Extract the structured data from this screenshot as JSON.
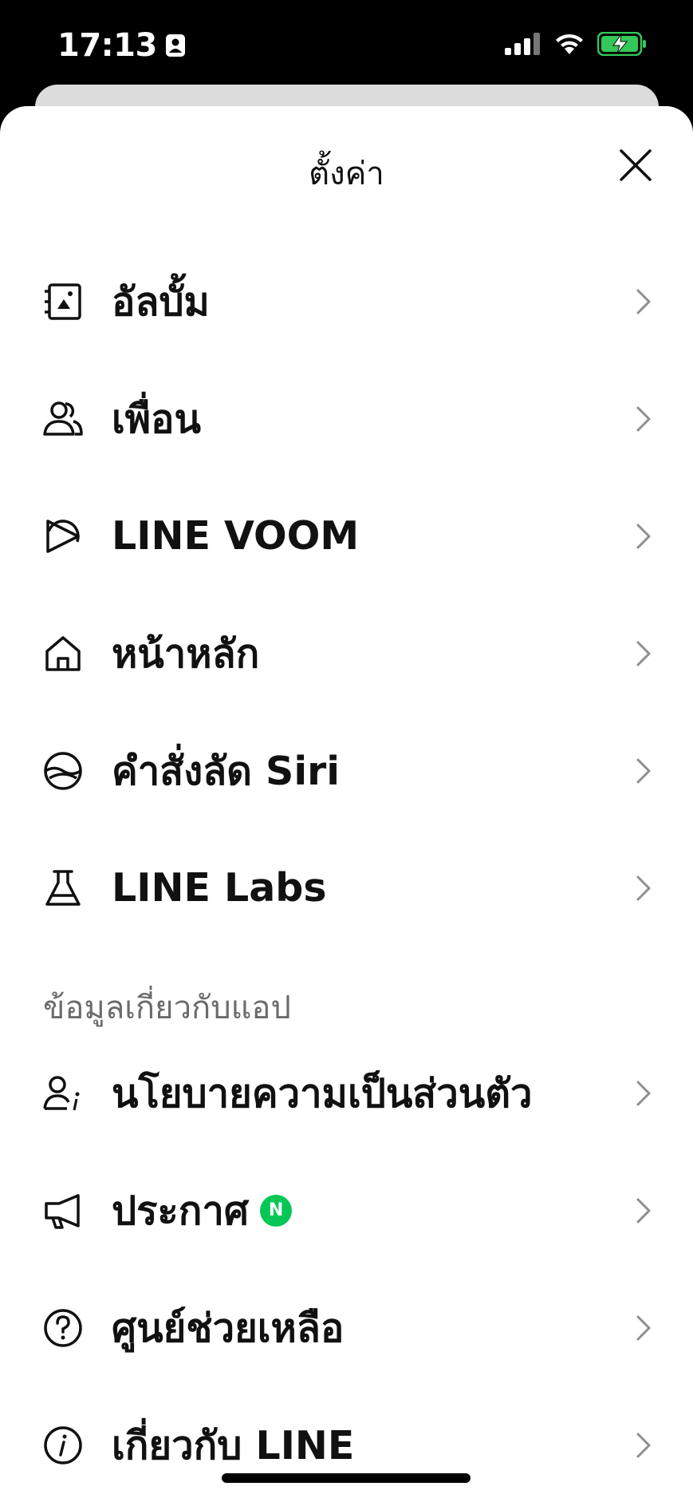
{
  "status_bar": {
    "time": "17:13"
  },
  "header": {
    "title": "ตั้งค่า"
  },
  "settings_items": [
    {
      "label": "อัลบั้ม",
      "icon": "album-icon"
    },
    {
      "label": "เพื่อน",
      "icon": "friends-icon"
    },
    {
      "label": "LINE VOOM",
      "icon": "voom-icon"
    },
    {
      "label": "หน้าหลัก",
      "icon": "home-icon"
    },
    {
      "label": "คำสั่งลัด Siri",
      "icon": "siri-shortcut-icon"
    },
    {
      "label": "LINE Labs",
      "icon": "flask-icon"
    }
  ],
  "app_info_section": {
    "header": "ข้อมูลเกี่ยวกับแอป",
    "items": [
      {
        "label": "นโยบายความเป็นส่วนตัว",
        "icon": "privacy-icon"
      },
      {
        "label": "ประกาศ",
        "icon": "megaphone-icon",
        "badge": "N"
      },
      {
        "label": "ศูนย์ช่วยเหลือ",
        "icon": "help-icon"
      },
      {
        "label": "เกี่ยวกับ LINE",
        "icon": "info-icon"
      }
    ]
  },
  "colors": {
    "badge_green": "#06c755",
    "battery_green": "#34c759",
    "section_gray": "#6b6b6b"
  }
}
